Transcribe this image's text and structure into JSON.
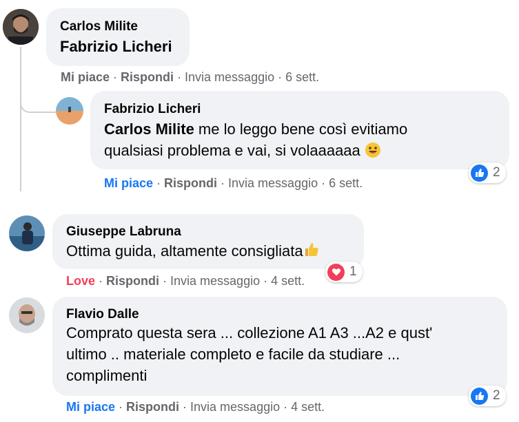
{
  "comments": [
    {
      "author": "Carlos Milite",
      "tag": "Fabrizio Licheri",
      "text": "",
      "actions": {
        "like": "Mi piace",
        "reply": "Rispondi",
        "message": "Invia messaggio",
        "time": "6 sett."
      }
    },
    {
      "author": "Fabrizio Licheri",
      "tag": "Carlos Milite",
      "text_line1": " me lo leggo bene così evitiamo",
      "text_line2": "qualsiasi problema e vai, si volaaaaaa",
      "emoji": "smiley-emoji",
      "actions": {
        "like": "Mi piace",
        "reply": "Rispondi",
        "message": "Invia messaggio",
        "time": "6 sett."
      },
      "reaction": {
        "icon": "thumbs-up-icon",
        "count": "2",
        "color": "#1877f2"
      }
    },
    {
      "author": "Giuseppe Labruna",
      "text": "Ottima guida, altamente consigliata",
      "emoji": "thumbs-up-emoji",
      "actions": {
        "like": "Love",
        "reply": "Rispondi",
        "message": "Invia messaggio",
        "time": "4 sett."
      },
      "reaction": {
        "icon": "heart-icon",
        "count": "1",
        "color": "#f33e58"
      }
    },
    {
      "author": "Flavio Dalle",
      "text_line1": "Comprato questa sera ... collezione A1 A3 ...A2 e qust'",
      "text_line2": "ultimo .. materiale completo e facile da studiare ...",
      "text_line3": "complimenti",
      "actions": {
        "like": "Mi piace",
        "reply": "Rispondi",
        "message": "Invia messaggio",
        "time": "4 sett."
      },
      "reaction": {
        "icon": "thumbs-up-icon",
        "count": "2",
        "color": "#1877f2"
      }
    }
  ],
  "colors": {
    "bubble": "#f0f2f5",
    "like_blue": "#1877f2",
    "love_red": "#f33e58",
    "meta_gray": "#65676b"
  }
}
